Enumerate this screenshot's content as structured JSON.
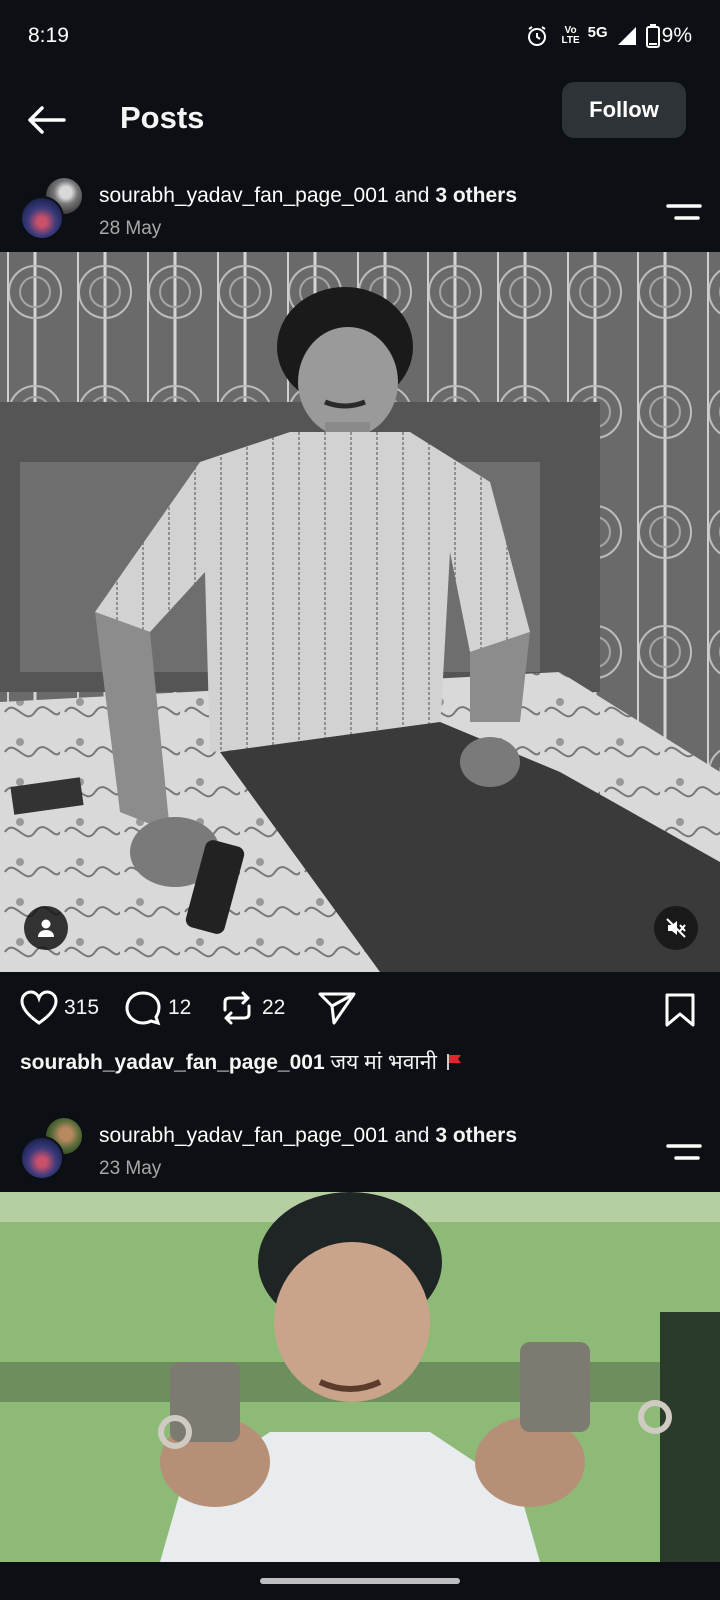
{
  "status_bar": {
    "time": "8:19",
    "volte": "Vo",
    "lte": "LTE",
    "network": "5G",
    "battery": "9%"
  },
  "header": {
    "title": "Posts",
    "follow_label": "Follow"
  },
  "posts": [
    {
      "username": "sourabh_yadav_fan_page_001",
      "joiner": "and",
      "others": "3 others",
      "date": "28 May",
      "likes": "315",
      "comments": "12",
      "reposts": "22",
      "caption_user": "sourabh_yadav_fan_page_001",
      "caption_text": "जय मां भवानी"
    },
    {
      "username": "sourabh_yadav_fan_page_001",
      "joiner": "and",
      "others": "3 others",
      "date": "23 May"
    }
  ],
  "icons": {
    "back": "arrow-left-icon",
    "menu": "menu-icon",
    "like": "heart-icon",
    "comment": "comment-icon",
    "repost": "repost-icon",
    "share": "send-icon",
    "save": "bookmark-icon",
    "tag": "person-icon",
    "mute": "speaker-muted-icon"
  }
}
